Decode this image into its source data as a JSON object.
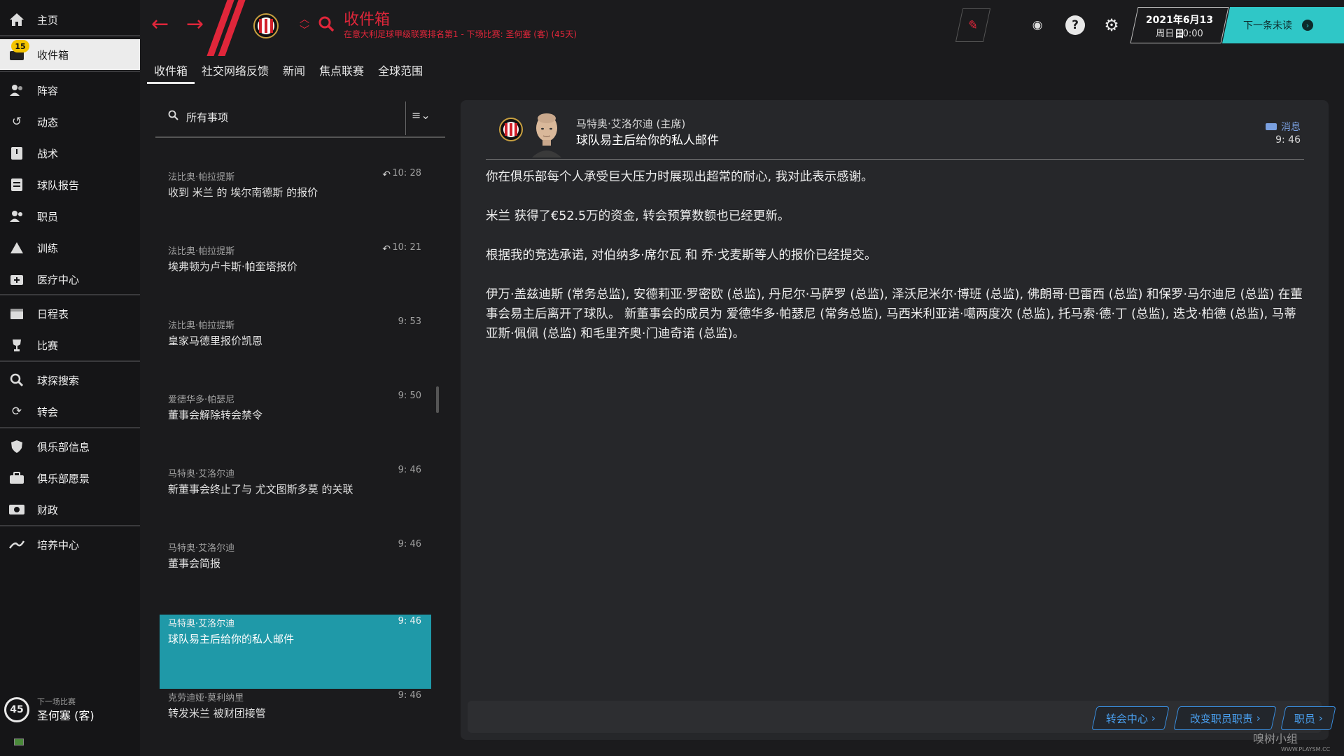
{
  "sidebar": {
    "badge_count": "15",
    "items": [
      {
        "label": "主页",
        "icon": "home-icon"
      },
      {
        "label": "收件箱",
        "icon": "inbox-icon"
      },
      {
        "label": "阵容",
        "icon": "squad-icon"
      },
      {
        "label": "动态",
        "icon": "dynamics-icon"
      },
      {
        "label": "战术",
        "icon": "tactics-icon"
      },
      {
        "label": "球队报告",
        "icon": "report-icon"
      },
      {
        "label": "职员",
        "icon": "staff-icon"
      },
      {
        "label": "训练",
        "icon": "training-icon"
      },
      {
        "label": "医疗中心",
        "icon": "medical-icon"
      },
      {
        "label": "日程表",
        "icon": "calendar-icon"
      },
      {
        "label": "比赛",
        "icon": "trophy-icon"
      },
      {
        "label": "球探搜索",
        "icon": "search-icon"
      },
      {
        "label": "转会",
        "icon": "transfer-icon"
      },
      {
        "label": "俱乐部信息",
        "icon": "shield-icon"
      },
      {
        "label": "俱乐部愿景",
        "icon": "briefcase-icon"
      },
      {
        "label": "财政",
        "icon": "money-icon"
      },
      {
        "label": "培养中心",
        "icon": "development-icon"
      }
    ],
    "next_match": {
      "label": "下一场比赛",
      "value": "圣何塞 (客)",
      "days": "45"
    }
  },
  "header": {
    "title": "收件箱",
    "subtitle": "在意大利足球甲级联赛排名第1 - 下场比赛: 圣何塞 (客) (45天)",
    "date_line1": "2021年6月13日",
    "date_line2": "周日 10:00",
    "next_unread": "下一条未读",
    "colors": {
      "accent": "#e0263a",
      "teal": "#2fc7c7"
    }
  },
  "tabs": [
    "收件箱",
    "社交网络反馈",
    "新闻",
    "焦点联赛",
    "全球范围"
  ],
  "inbox": {
    "filter_label": "所有事项",
    "messages": [
      {
        "sender": "法比奥·帕拉提斯",
        "subject": "收到 米兰 的 埃尔南德斯 的报价",
        "time": "10: 28",
        "replied": true
      },
      {
        "sender": "法比奥·帕拉提斯",
        "subject": "埃弗顿为卢卡斯·帕奎塔报价",
        "time": "10: 21",
        "replied": true
      },
      {
        "sender": "法比奥·帕拉提斯",
        "subject": "皇家马德里报价凯恩",
        "time": "9: 53",
        "replied": false
      },
      {
        "sender": "爱德华多·帕瑟尼",
        "subject": "董事会解除转会禁令",
        "time": "9: 50",
        "replied": false
      },
      {
        "sender": "马特奥·艾洛尔迪",
        "subject": "新董事会终止了与 尤文图斯多莫 的关联",
        "time": "9: 46",
        "replied": false
      },
      {
        "sender": "马特奥·艾洛尔迪",
        "subject": "董事会简报",
        "time": "9: 46",
        "replied": false
      },
      {
        "sender": "马特奥·艾洛尔迪",
        "subject": "球队易主后给你的私人邮件",
        "time": "9: 46",
        "replied": false
      },
      {
        "sender": "克劳迪娅·莫利纳里",
        "subject": "转发米兰 被财团接管",
        "time": "9: 46",
        "replied": false
      }
    ]
  },
  "reader": {
    "from": "马特奥·艾洛尔迪 (主席)",
    "subject": "球队易主后给你的私人邮件",
    "type": "消息",
    "time": "9: 46",
    "paragraphs": [
      "你在俱乐部每个人承受巨大压力时展现出超常的耐心, 我对此表示感谢。",
      "米兰 获得了€52.5万的资金, 转会预算数额也已经更新。",
      "根据我的竞选承诺, 对伯纳多·席尔瓦 和 乔·戈麦斯等人的报价已经提交。",
      "伊万·盖兹迪斯 (常务总监), 安德莉亚·罗密欧 (总监), 丹尼尔·马萨罗 (总监), 泽沃尼米尔·博班 (总监), 佛朗哥·巴雷西 (总监) 和保罗·马尔迪尼 (总监) 在董事会易主后离开了球队。 新董事会的成员为 爱德华多·帕瑟尼 (常务总监), 马西米利亚诺·噶两度次 (总监), 托马索·德·丁 (总监), 迭戈·柏德 (总监), 马蒂亚斯·佩佩 (总监) 和毛里齐奥·门迪奇诺 (总监)。"
    ],
    "actions": [
      "转会中心",
      "改变职员职责",
      "职员"
    ]
  },
  "watermark": {
    "text": "嗅树小组",
    "url": "WWW.PLAYSM.CC"
  }
}
